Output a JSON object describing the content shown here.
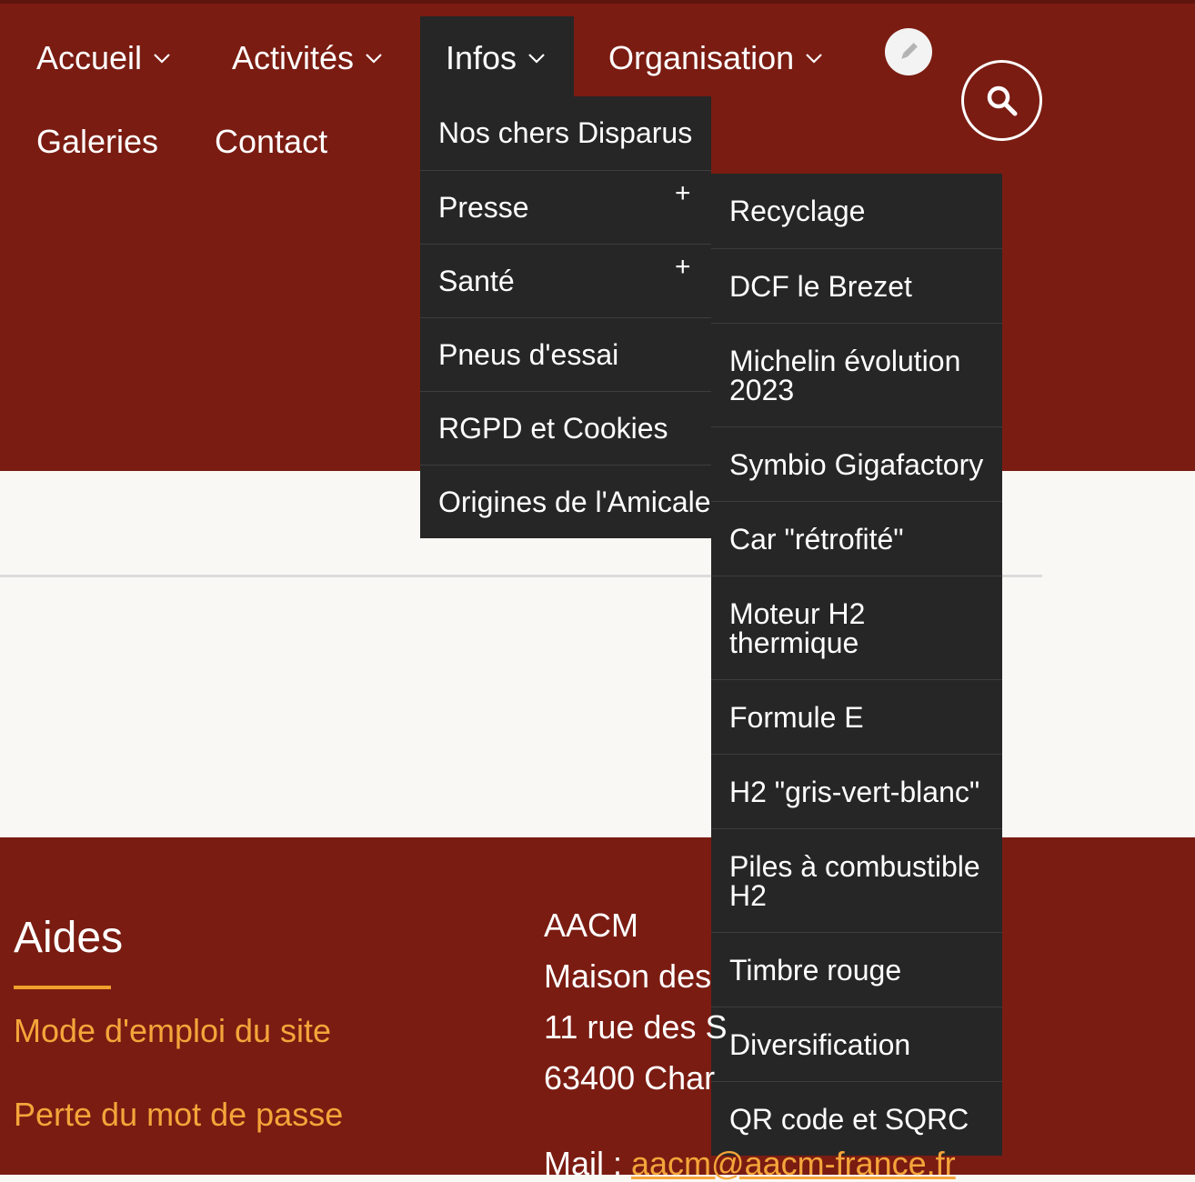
{
  "nav": {
    "items": [
      {
        "label": "Accueil",
        "has_chevron": true
      },
      {
        "label": "Activités",
        "has_chevron": true
      },
      {
        "label": "Infos",
        "has_chevron": true,
        "active": true
      },
      {
        "label": "Organisation",
        "has_chevron": true
      },
      {
        "label": "Galeries",
        "has_chevron": false
      },
      {
        "label": "Contact",
        "has_chevron": false
      }
    ],
    "edit_icon": "pencil-icon",
    "search_icon": "search-icon"
  },
  "infos_menu": {
    "items": [
      {
        "label": "Nos chers Disparus"
      },
      {
        "label": "Presse",
        "expand": "+"
      },
      {
        "label": "Santé",
        "expand": "+"
      },
      {
        "label": "Pneus d'essai"
      },
      {
        "label": "RGPD et Cookies"
      },
      {
        "label": "Origines de l'Amicale"
      }
    ]
  },
  "presse_submenu": {
    "items": [
      {
        "label": "Recyclage"
      },
      {
        "label": "DCF le Brezet"
      },
      {
        "label": "Michelin évolution 2023"
      },
      {
        "label": "Symbio Gigafactory"
      },
      {
        "label": "Car \"rétrofité\""
      },
      {
        "label": "Moteur H2 thermique"
      },
      {
        "label": "Formule E"
      },
      {
        "label": "H2 \"gris-vert-blanc\""
      },
      {
        "label": "Piles à combustible H2"
      },
      {
        "label": "Timbre rouge"
      },
      {
        "label": "Diversification"
      },
      {
        "label": "QR code et SQRC"
      }
    ]
  },
  "footer": {
    "aides": {
      "title": "Aides",
      "links": [
        "Mode d'emploi du site",
        "Perte du mot de passe"
      ]
    },
    "address": {
      "lines": [
        "AACM",
        "Maison des",
        "11 rue des S",
        "63400 Char"
      ],
      "mail_label": "Mail : ",
      "mail_value": "aacm@aacm-france.fr"
    }
  },
  "colors": {
    "brand_red": "#7a1c12",
    "menu_dark": "#262626",
    "accent_orange": "#f5a53a",
    "content_bg": "#faf8f4"
  }
}
